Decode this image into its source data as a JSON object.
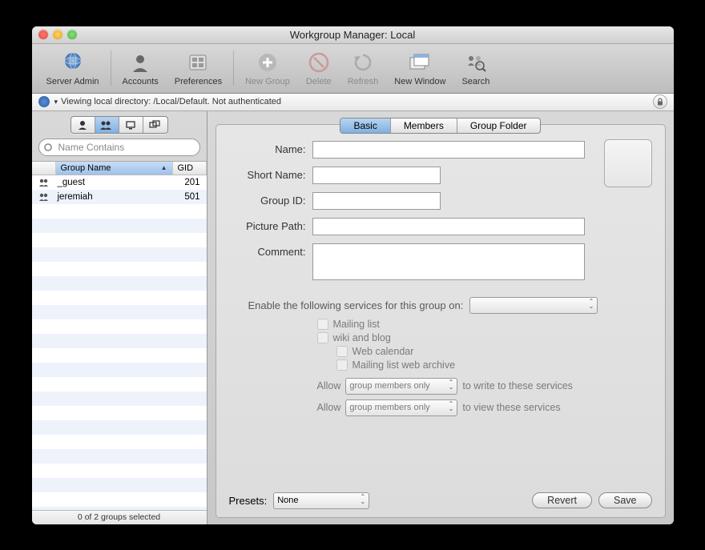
{
  "window": {
    "title": "Workgroup Manager: Local"
  },
  "toolbar": {
    "server_admin": "Server Admin",
    "accounts": "Accounts",
    "preferences": "Preferences",
    "new_group": "New Group",
    "delete": "Delete",
    "refresh": "Refresh",
    "new_window": "New Window",
    "search": "Search"
  },
  "status": {
    "text": "Viewing local directory: /Local/Default.  Not authenticated"
  },
  "sidebar": {
    "search_placeholder": "Name Contains",
    "columns": {
      "name": "Group Name",
      "gid": "GID"
    },
    "rows": [
      {
        "name": "_guest",
        "gid": "201"
      },
      {
        "name": "jeremiah",
        "gid": "501"
      }
    ],
    "footer": "0 of 2 groups selected"
  },
  "tabs": {
    "basic": "Basic",
    "members": "Members",
    "group_folder": "Group Folder"
  },
  "form": {
    "name_label": "Name:",
    "short_name_label": "Short Name:",
    "group_id_label": "Group ID:",
    "picture_path_label": "Picture Path:",
    "comment_label": "Comment:"
  },
  "services": {
    "enable_label": "Enable the following services for this group on:",
    "mailing_list": "Mailing list",
    "wiki_blog": "wiki and blog",
    "web_calendar": "Web calendar",
    "mailing_archive": "Mailing list web archive",
    "allow": "Allow",
    "select_value": "group members only",
    "write_suffix": "to write to these services",
    "view_suffix": "to view these services"
  },
  "bottom": {
    "presets_label": "Presets:",
    "presets_value": "None",
    "revert": "Revert",
    "save": "Save"
  }
}
